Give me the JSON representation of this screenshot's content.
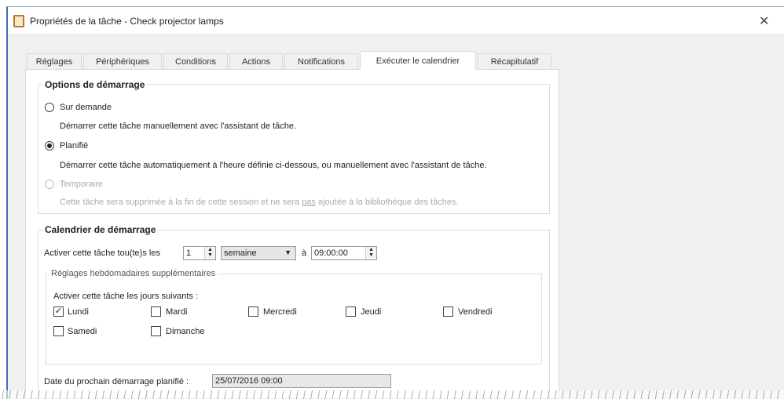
{
  "window": {
    "title": "Propriétés de la tâche - Check projector lamps",
    "close": "✕"
  },
  "tabs": [
    "Réglages",
    "Périphériques",
    "Conditions",
    "Actions",
    "Notifications",
    "Exécuter le calendrier",
    "Récapitulatif"
  ],
  "active_tab": "Exécuter le calendrier",
  "startup_options": {
    "title": "Options de démarrage",
    "on_demand": {
      "label": "Sur demande",
      "desc": "Démarrer cette tâche manuellement avec l'assistant de tâche.",
      "selected": false
    },
    "scheduled": {
      "label": "Planifié",
      "desc": "Démarrer cette tâche automatiquement à l'heure définie ci-dessous, ou manuellement avec l'assistant de tâche.",
      "selected": true
    },
    "temporary": {
      "label": "Temporaire",
      "desc_pre": "Cette tâche sera supprimée à la fin de cette session et ne sera ",
      "desc_u": "pas",
      "desc_post": " ajoutée à la bibliothèque des tâches.",
      "enabled": false
    }
  },
  "schedule": {
    "title": "Calendrier de démarrage",
    "every_label": "Activer cette tâche tou(te)s les",
    "interval": "1",
    "unit": "semaine",
    "at_label": "à",
    "time": "09:00:00",
    "weekly": {
      "title": "Réglages hebdomadaires supplémentaires",
      "days_label": "Activer cette tâche les jours suivants :",
      "days": [
        {
          "label": "Lundi",
          "checked": true
        },
        {
          "label": "Mardi",
          "checked": false
        },
        {
          "label": "Mercredi",
          "checked": false
        },
        {
          "label": "Jeudi",
          "checked": false
        },
        {
          "label": "Vendredi",
          "checked": false
        },
        {
          "label": "Samedi",
          "checked": false
        },
        {
          "label": "Dimanche",
          "checked": false
        }
      ]
    },
    "next_label": "Date du prochain démarrage planifié :",
    "next_value": "25/07/2016 09:00"
  }
}
